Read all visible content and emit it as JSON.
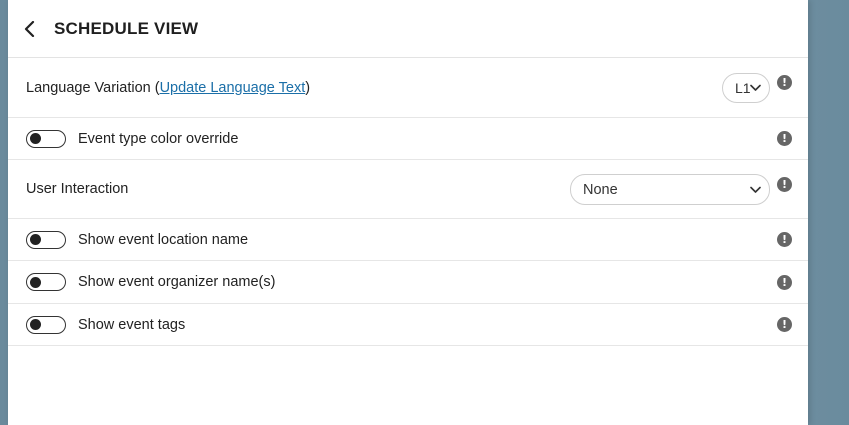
{
  "header": {
    "title": "SCHEDULE VIEW"
  },
  "settings": {
    "language": {
      "label_prefix": "Language Variation (",
      "link_text": "Update Language Text",
      "label_suffix": ")",
      "selected": "L1",
      "info": "!"
    },
    "color_override": {
      "label": "Event type color override",
      "enabled": false,
      "info": "!"
    },
    "user_interaction": {
      "label": "User Interaction",
      "selected": "None",
      "info": "!"
    },
    "location_name": {
      "label": "Show event location name",
      "enabled": false,
      "info": "!"
    },
    "organizer_name": {
      "label": "Show event organizer name(s)",
      "enabled": false,
      "info": "!"
    },
    "event_tags": {
      "label": "Show event tags",
      "enabled": false,
      "info": "!"
    }
  },
  "icons": {
    "back": "chevron-left-icon",
    "dropdown": "chevron-down-icon",
    "info": "info-icon"
  },
  "colors": {
    "link": "#1b6fa8",
    "info_icon": "#666666",
    "backdrop": "#6f8fa1"
  }
}
